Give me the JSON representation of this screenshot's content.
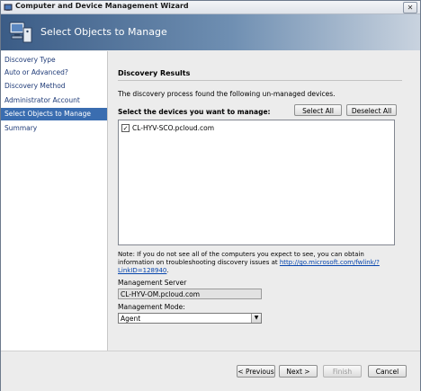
{
  "window": {
    "title": "Computer and Device Management Wizard",
    "close_glyph": "✕"
  },
  "header": {
    "title": "Select Objects to Manage",
    "icon": "wizard-icon"
  },
  "nav": {
    "items": [
      {
        "label": "Discovery Type"
      },
      {
        "label": "Auto or Advanced?"
      },
      {
        "label": "Discovery Method"
      },
      {
        "label": "Administrator Account"
      },
      {
        "label": "Select Objects to Manage"
      },
      {
        "label": "Summary"
      }
    ],
    "selected_index": 4
  },
  "main": {
    "section_title": "Discovery Results",
    "description": "The discovery process found the following un-managed devices.",
    "select_label": "Select the devices you want to manage:",
    "select_all_label": "Select All",
    "deselect_all_label": "Deselect All",
    "devices": [
      {
        "name": "CL-HYV-SCO.pcloud.com",
        "checked": true,
        "check_glyph": "✓"
      }
    ],
    "note_text": "Note: If you do not see all of the computers you expect to see, you can obtain information on troubleshooting discovery issues at ",
    "note_link": "http://go.microsoft.com/fwlink/?LinkID=128940",
    "note_suffix": ".",
    "management_server_label": "Management Server",
    "management_server_value": "CL-HYV-OM.pcloud.com",
    "management_mode_label": "Management Mode:",
    "management_mode_value": "Agent",
    "dropdown_glyph": "▼"
  },
  "footer": {
    "previous_label": "< Previous",
    "next_label": "Next >",
    "finish_label": "Finish",
    "cancel_label": "Cancel"
  },
  "colors": {
    "nav_selected": "#3a6db0",
    "nav_text": "#1f3b78",
    "header_dark": "#3b5c86",
    "link": "#0645ad"
  }
}
